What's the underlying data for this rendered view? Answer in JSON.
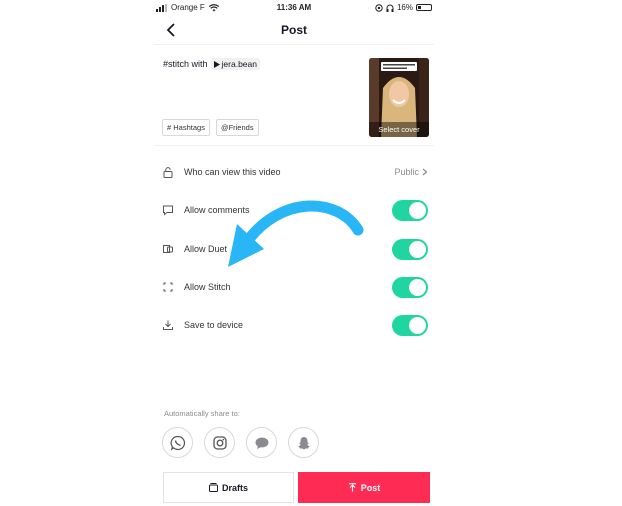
{
  "status_bar": {
    "carrier": "Orange F",
    "time": "11:36 AM",
    "battery": "16%"
  },
  "header": {
    "title": "Post"
  },
  "caption": {
    "text": "#stitch with",
    "mention": "jera.bean"
  },
  "cover": {
    "label": "Select cover"
  },
  "chips": {
    "hashtags": "Hashtags",
    "friends": "@Friends"
  },
  "settings": {
    "who_can_view": {
      "label": "Who can view this video",
      "value": "Public"
    },
    "allow_comments": {
      "label": "Allow comments",
      "on": true
    },
    "allow_duet": {
      "label": "Allow Duet",
      "on": true
    },
    "allow_stitch": {
      "label": "Allow Stitch",
      "on": true
    },
    "save_to_device": {
      "label": "Save to device",
      "on": true
    }
  },
  "share": {
    "label": "Automatically share to:",
    "targets": [
      "whatsapp-icon",
      "instagram-icon",
      "message-icon",
      "snapchat-icon"
    ]
  },
  "buttons": {
    "drafts": "Drafts",
    "post": "Post"
  },
  "colors": {
    "accent": "#fe2c55",
    "toggle_on": "#20d5a0",
    "annotation_arrow": "#29b6f6"
  }
}
